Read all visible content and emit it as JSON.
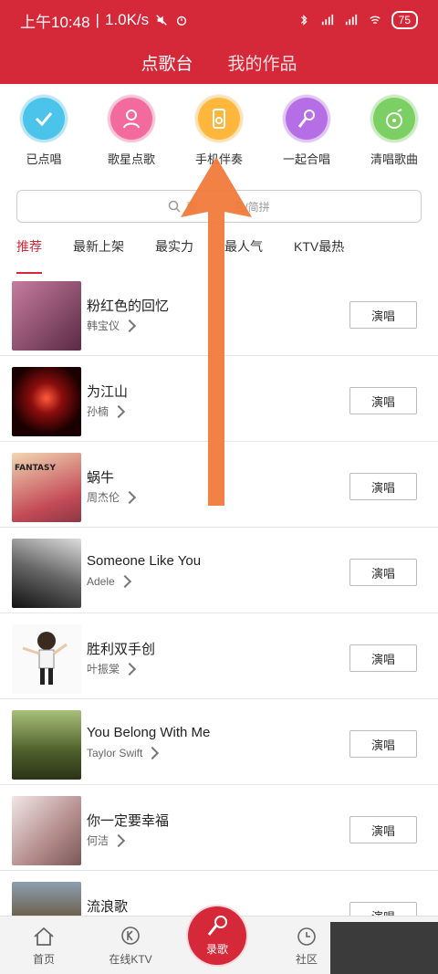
{
  "status_bar": {
    "time": "上午10:48",
    "speed": "1.0K/s",
    "battery": "75"
  },
  "header": {
    "tabs": [
      {
        "label": "点歌台"
      },
      {
        "label": "我的作品"
      }
    ]
  },
  "quick_actions": [
    {
      "label": "已点唱",
      "color": "#4cc3ea",
      "icon": "check-icon"
    },
    {
      "label": "歌星点歌",
      "color": "#f36a9c",
      "icon": "person-icon"
    },
    {
      "label": "手机伴奏",
      "color": "#ffb63c",
      "icon": "speaker-icon"
    },
    {
      "label": "一起合唱",
      "color": "#b56ee6",
      "icon": "microphone-icon"
    },
    {
      "label": "清唱歌曲",
      "color": "#7ccf62",
      "icon": "note-icon"
    }
  ],
  "search": {
    "placeholder_prefix": "歌",
    "placeholder_suffix": "名/简拼"
  },
  "categories": [
    {
      "label": "推荐"
    },
    {
      "label": "最新上架"
    },
    {
      "label": "最实力"
    },
    {
      "label": "最人气"
    },
    {
      "label": "KTV最热"
    }
  ],
  "songs": [
    {
      "title": "粉红色的回忆",
      "artist": "韩宝仪",
      "button": "演唱",
      "color": "#7a3d60"
    },
    {
      "title": "为江山",
      "artist": "孙楠",
      "button": "演唱",
      "color": "#9b1b1b"
    },
    {
      "title": "蜗牛",
      "artist": "周杰伦",
      "button": "演唱",
      "color": "#c8a06a",
      "thumb_text": "FANTASY"
    },
    {
      "title": "Someone Like You",
      "artist": "Adele",
      "button": "演唱",
      "color": "#3a3a3a"
    },
    {
      "title": "胜利双手创",
      "artist": "叶振棠",
      "button": "演唱",
      "color": "#f0f0f0"
    },
    {
      "title": "You Belong With Me",
      "artist": "Taylor Swift",
      "button": "演唱",
      "color": "#5a6f3a"
    },
    {
      "title": "你一定要幸福",
      "artist": "何洁",
      "button": "演唱",
      "color": "#c7a7a7"
    },
    {
      "title": "流浪歌",
      "artist": "",
      "button": "演唱",
      "color": "#6a5a44"
    }
  ],
  "bottom_nav": [
    {
      "label": "首页",
      "icon": "home-icon"
    },
    {
      "label": "在线KTV",
      "icon": "ktv-icon"
    },
    {
      "label": "录歌",
      "icon": "record-icon"
    },
    {
      "label": "社区",
      "icon": "clock-icon"
    }
  ],
  "colors": {
    "brand_red": "#d52838",
    "arrow_orange": "#f07a3a"
  }
}
